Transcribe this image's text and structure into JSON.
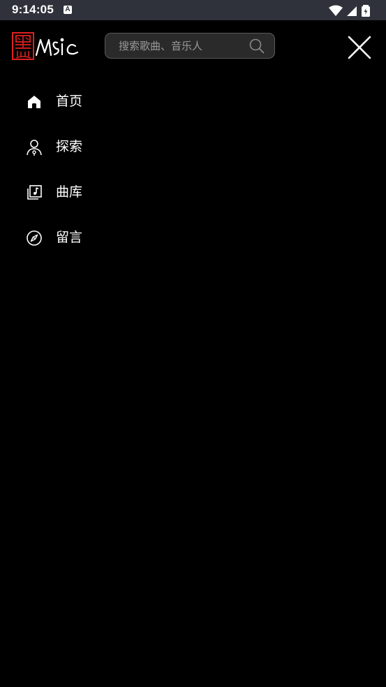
{
  "status_bar": {
    "time": "9:14:05",
    "notification_badge": "A",
    "icons": [
      "wifi-icon",
      "cell-signal-icon",
      "battery-icon"
    ]
  },
  "header": {
    "logo_icon": "hei-music-logo",
    "search": {
      "placeholder": "搜索歌曲、音乐人",
      "value": "",
      "icon": "search-icon"
    },
    "close_icon": "close-icon"
  },
  "menu": {
    "items": [
      {
        "label": "首页",
        "icon": "home-icon"
      },
      {
        "label": "探索",
        "icon": "explore-person-icon"
      },
      {
        "label": "曲库",
        "icon": "music-library-icon"
      },
      {
        "label": "留言",
        "icon": "compass-icon"
      }
    ]
  },
  "colors": {
    "background": "#000000",
    "status_bar": "#30323b",
    "text": "#ffffff",
    "logo_red": "#e02020",
    "search_border": "#5a5a5a",
    "search_bg": "#2a2a2a",
    "placeholder": "#9a9a9a"
  }
}
